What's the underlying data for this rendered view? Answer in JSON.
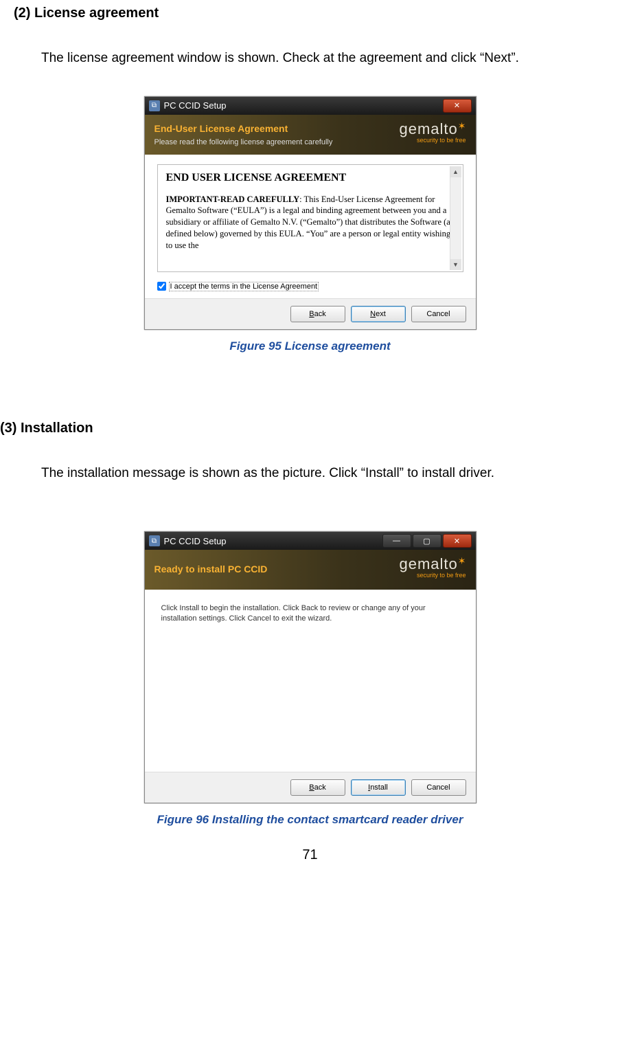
{
  "section1": {
    "heading": "(2) License agreement",
    "body": "The license agreement window is shown. Check at the agreement and click “Next”.",
    "caption": "Figure 95 License agreement"
  },
  "section2": {
    "heading": "(3) Installation",
    "body": "The installation message is shown as the picture. Click “Install” to install driver.",
    "caption": "Figure 96 Installing the contact smartcard reader driver"
  },
  "dlg1": {
    "title": "PC CCID Setup",
    "banner_title": "End-User License Agreement",
    "banner_sub": "Please read the following license agreement carefully",
    "brand": "gemalto",
    "tagline": "security to be free",
    "eula_heading": "END USER LICENSE AGREEMENT",
    "eula_strong": "IMPORTANT-READ CAREFULLY",
    "eula_rest": ":  This End-User License Agreement for Gemalto Software (“EULA”) is a legal and binding agreement between you and a subsidiary or affiliate of Gemalto N.V. (“Gemalto”) that distributes the Software (as defined below) governed by this EULA.  “You” are a person or legal entity wishing to use the",
    "accept_label": "I accept the terms in the License Agreement",
    "btn_back_prefix": "B",
    "btn_back_rest": "ack",
    "btn_next_prefix": "N",
    "btn_next_rest": "ext",
    "btn_cancel": "Cancel"
  },
  "dlg2": {
    "title": "PC CCID Setup",
    "banner_title": "Ready to install PC CCID",
    "brand": "gemalto",
    "tagline": "security to be free",
    "body": "Click Install to begin the installation. Click Back to review or change any of your installation settings. Click Cancel to exit the wizard.",
    "btn_back_prefix": "B",
    "btn_back_rest": "ack",
    "btn_install_prefix": "I",
    "btn_install_rest": "nstall",
    "btn_cancel": "Cancel"
  },
  "page_number": "71"
}
